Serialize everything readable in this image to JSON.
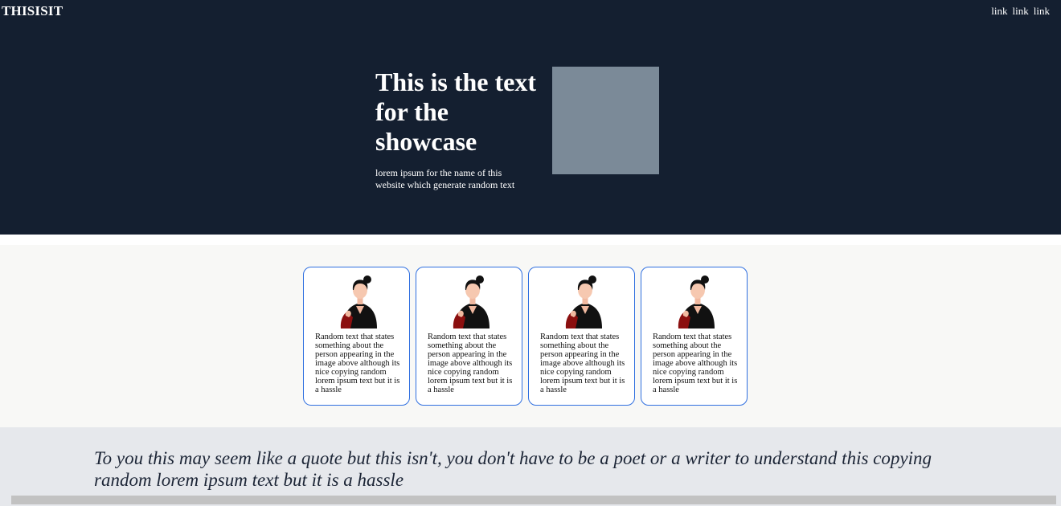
{
  "header": {
    "brand": "THISISIT",
    "nav_links": [
      "link",
      "link",
      "link"
    ]
  },
  "showcase": {
    "title": "This is the text for the showcase",
    "subtitle": "lorem ipsum for the name of this website which generate random text"
  },
  "cards": [
    {
      "text": "Random text that states something about the person appearing in the image above although its nice copying random lorem ipsum text but it is a hassle"
    },
    {
      "text": "Random text that states something about the person appearing in the image above although its nice copying random lorem ipsum text but it is a hassle"
    },
    {
      "text": "Random text that states something about the person appearing in the image above although its nice copying random lorem ipsum text but it is a hassle"
    },
    {
      "text": "Random text that states something about the person appearing in the image above although its nice copying random lorem ipsum text but it is a hassle"
    }
  ],
  "quote": {
    "text": "To you this may seem like a quote but this isn't, you don't have to be a poet or a writer to understand this copying random lorem ipsum text but it is a hassle"
  },
  "colors": {
    "hero_bg": "#141f30",
    "placeholder_image": "#7b8a98",
    "card_border": "#2f6fe0",
    "quote_bg": "#e6e8ec"
  }
}
